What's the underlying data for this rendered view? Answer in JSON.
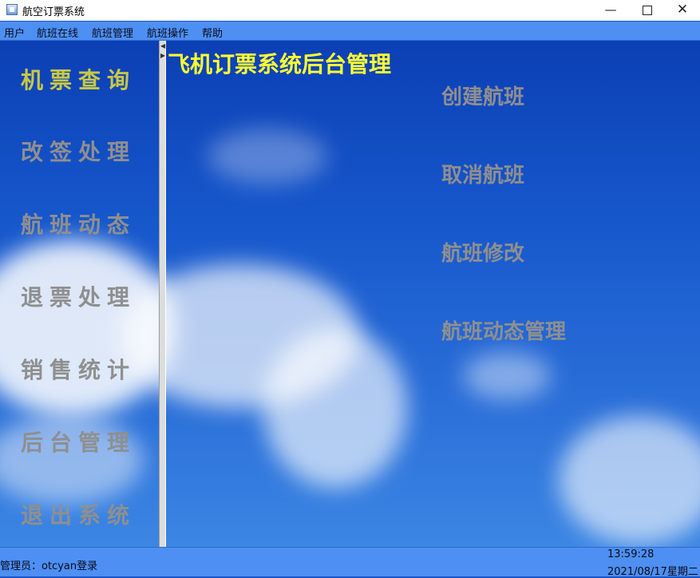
{
  "window": {
    "title": "航空订票系统",
    "minimize_glyph": "—",
    "close_glyph": "✕"
  },
  "menu": [
    "用户",
    "航班在线",
    "航班管理",
    "航班操作",
    "帮助"
  ],
  "sidebar": {
    "items": [
      {
        "label": "机票查询",
        "active": true
      },
      {
        "label": "改签处理",
        "active": false
      },
      {
        "label": "航班动态",
        "active": false
      },
      {
        "label": "退票处理",
        "active": false
      },
      {
        "label": "销售统计",
        "active": false
      },
      {
        "label": "后台管理",
        "active": false
      },
      {
        "label": "退出系统",
        "active": false
      }
    ]
  },
  "splitter": {
    "up_arrow": "◀",
    "down_arrow": "▶"
  },
  "panel": {
    "title": "飞机订票系统后台管理",
    "actions": [
      "创建航班",
      "取消航班",
      "航班修改",
      "航班动态管理"
    ]
  },
  "status": {
    "user": "管理员：otcyan登录",
    "time": "13:59:28",
    "date": "2021/08/17星期二"
  },
  "colors": {
    "menubar": "#4d8ff2",
    "active_nav": "#c8c845",
    "inactive_text": "#8f8f8f",
    "panel_title": "#ffff33"
  }
}
